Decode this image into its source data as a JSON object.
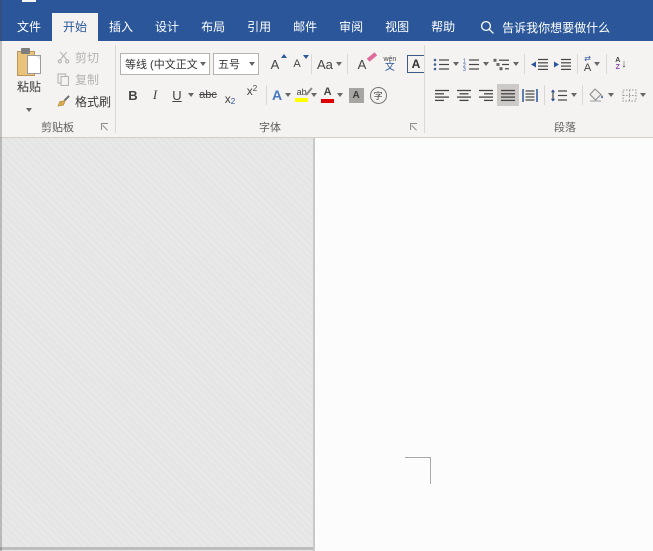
{
  "colors": {
    "accent": "#2b579a",
    "ribbon_bg": "#f4f3f1",
    "highlight_yellow": "#ffff00",
    "font_color_red": "#e00000"
  },
  "tabs": {
    "file": {
      "label": "文件"
    },
    "ribbon_tabs": [
      {
        "id": "home",
        "label": "开始",
        "selected": true
      },
      {
        "id": "insert",
        "label": "插入"
      },
      {
        "id": "design",
        "label": "设计"
      },
      {
        "id": "layout",
        "label": "布局"
      },
      {
        "id": "references",
        "label": "引用"
      },
      {
        "id": "mailings",
        "label": "邮件"
      },
      {
        "id": "review",
        "label": "审阅"
      },
      {
        "id": "view",
        "label": "视图"
      },
      {
        "id": "help",
        "label": "帮助"
      }
    ],
    "search_label": "告诉我你想要做什么"
  },
  "ribbon": {
    "clipboard": {
      "group_label": "剪贴板",
      "paste_label": "粘贴",
      "cut_label": "剪切",
      "copy_label": "复制",
      "format_painter_label": "格式刷"
    },
    "font": {
      "group_label": "字体",
      "font_name_value": "等线 (中文正文",
      "font_size_value": "五号",
      "grow_font": "A",
      "shrink_font": "A",
      "change_case": "Aa",
      "clear_format": "A",
      "pinyin_top": "wén",
      "pinyin_bottom": "文",
      "char_border": "A",
      "bold": "B",
      "italic": "I",
      "underline": "U",
      "strikethrough": "abc",
      "sub_base": "x",
      "sub_num": "2",
      "sup_base": "x",
      "sup_num": "2",
      "text_effects": "A",
      "highlight": "ab",
      "font_color": "A",
      "char_shading": "A",
      "enclose_char": "字"
    },
    "paragraph": {
      "group_label": "段落",
      "asian_layout_arrows": "⇄",
      "asian_layout_letter": "A",
      "sort_a": "A",
      "sort_z": "Z",
      "sort_arrow": "↓"
    }
  }
}
